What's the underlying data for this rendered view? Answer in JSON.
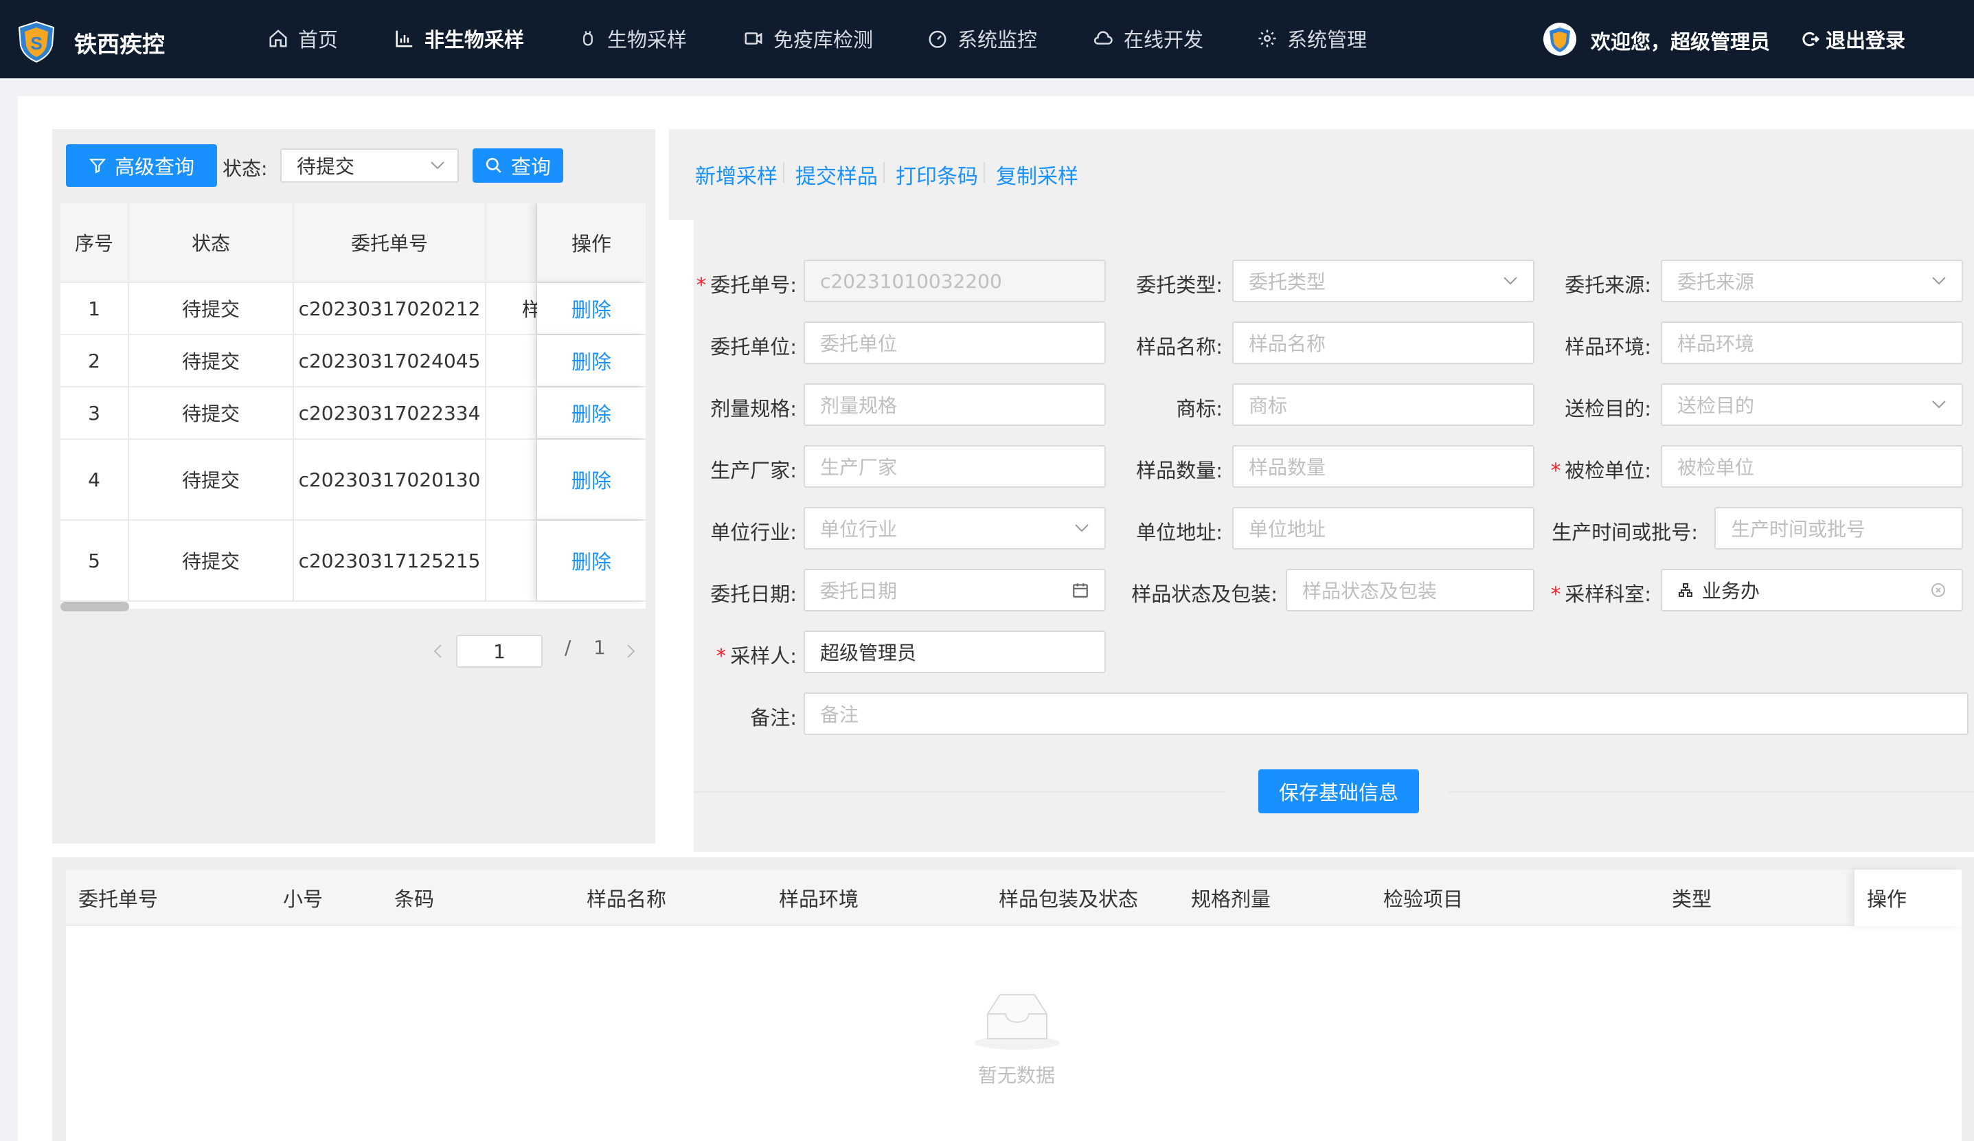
{
  "header": {
    "brand": "铁西疾控",
    "nav": [
      {
        "label": "首页",
        "icon": "home-icon"
      },
      {
        "label": "非生物采样",
        "icon": "bar-chart-icon"
      },
      {
        "label": "生物采样",
        "icon": "bug-icon"
      },
      {
        "label": "免疫库检测",
        "icon": "video-icon"
      },
      {
        "label": "系统监控",
        "icon": "dashboard-icon"
      },
      {
        "label": "在线开发",
        "icon": "cloud-icon"
      },
      {
        "label": "系统管理",
        "icon": "gear-icon"
      }
    ],
    "active_nav": "非生物采样",
    "welcome": "欢迎您，超级管理员",
    "logout": "退出登录"
  },
  "left": {
    "advanced_query": "高级查询",
    "status_label": "状态:",
    "status_value": "待提交",
    "query_button": "查询",
    "table": {
      "headers": [
        "序号",
        "状态",
        "委托单号",
        "操作"
      ],
      "rows": [
        {
          "no": "1",
          "status": "待提交",
          "order": "c20230317020212",
          "extra": "样",
          "op": "删除"
        },
        {
          "no": "2",
          "status": "待提交",
          "order": "c20230317024045",
          "extra": "",
          "op": "删除"
        },
        {
          "no": "3",
          "status": "待提交",
          "order": "c20230317022334",
          "extra": "",
          "op": "删除"
        },
        {
          "no": "4",
          "status": "待提交",
          "order": "c20230317020130",
          "extra": "",
          "op": "删除"
        },
        {
          "no": "5",
          "status": "待提交",
          "order": "c20230317125215",
          "extra": "",
          "op": "删除"
        }
      ]
    },
    "pager": {
      "current": "1",
      "separator": "/",
      "total": "1"
    }
  },
  "actions": [
    "新增采样",
    "提交样品",
    "打印条码",
    "复制采样"
  ],
  "form": {
    "order_no": {
      "label": "委托单号:",
      "value": "c20231010032200"
    },
    "order_type": {
      "label": "委托类型:",
      "placeholder": "委托类型"
    },
    "order_source": {
      "label": "委托来源:",
      "placeholder": "委托来源"
    },
    "unit": {
      "label": "委托单位:",
      "placeholder": "委托单位"
    },
    "sample_name": {
      "label": "样品名称:",
      "placeholder": "样品名称"
    },
    "sample_env": {
      "label": "样品环境:",
      "placeholder": "样品环境"
    },
    "dose_spec": {
      "label": "剂量规格:",
      "placeholder": "剂量规格"
    },
    "brand": {
      "label": "商标:",
      "placeholder": "商标"
    },
    "purpose": {
      "label": "送检目的:",
      "placeholder": "送检目的"
    },
    "manufacturer": {
      "label": "生产厂家:",
      "placeholder": "生产厂家"
    },
    "sample_qty": {
      "label": "样品数量:",
      "placeholder": "样品数量"
    },
    "inspected_unit": {
      "label": "被检单位:",
      "placeholder": "被检单位"
    },
    "industry": {
      "label": "单位行业:",
      "placeholder": "单位行业"
    },
    "address": {
      "label": "单位地址:",
      "placeholder": "单位地址"
    },
    "batch": {
      "label": "生产时间或批号:",
      "placeholder": "生产时间或批号"
    },
    "date": {
      "label": "委托日期:",
      "placeholder": "委托日期"
    },
    "package": {
      "label": "样品状态及包装:",
      "placeholder": "样品状态及包装"
    },
    "dept": {
      "label": "采样科室:",
      "value": "业务办"
    },
    "sampler": {
      "label": "采样人:",
      "value": "超级管理员"
    },
    "remark": {
      "label": "备注:",
      "placeholder": "备注"
    },
    "required_mark": "*",
    "save": "保存基础信息"
  },
  "bottom": {
    "headers": [
      "委托单号",
      "小号",
      "条码",
      "样品名称",
      "样品环境",
      "样品包装及状态",
      "规格剂量",
      "检验项目",
      "类型",
      "操作"
    ],
    "empty": "暂无数据"
  },
  "colors": {
    "primary": "#1890ff",
    "header_bg": "#0f1c2e",
    "required": "#f5222d"
  }
}
